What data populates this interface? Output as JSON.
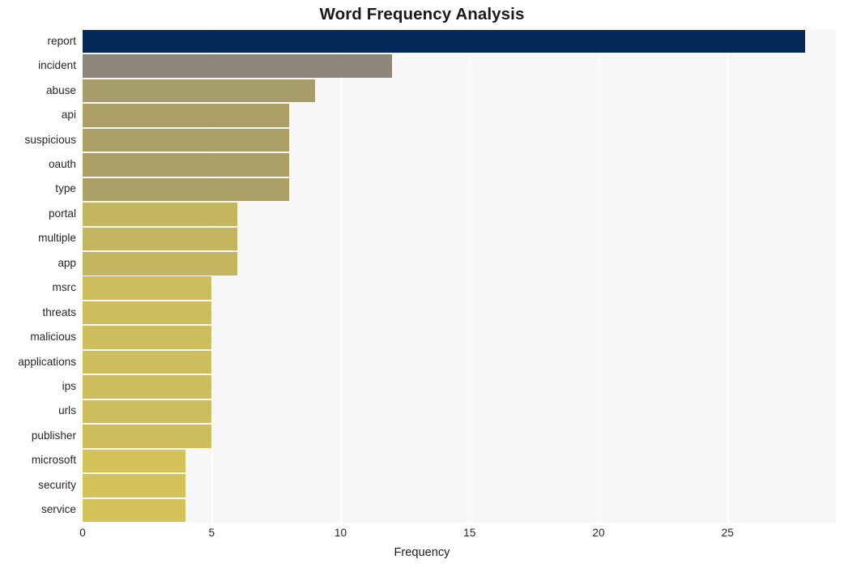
{
  "chart_data": {
    "type": "bar",
    "orientation": "horizontal",
    "title": "Word Frequency Analysis",
    "xlabel": "Frequency",
    "ylabel": "",
    "categories": [
      "report",
      "incident",
      "abuse",
      "api",
      "suspicious",
      "oauth",
      "type",
      "portal",
      "multiple",
      "app",
      "msrc",
      "threats",
      "malicious",
      "applications",
      "ips",
      "urls",
      "publisher",
      "microsoft",
      "security",
      "service"
    ],
    "values": [
      28,
      12,
      9,
      8,
      8,
      8,
      8,
      6,
      6,
      6,
      5,
      5,
      5,
      5,
      5,
      5,
      5,
      4,
      4,
      4
    ],
    "xlim": [
      0,
      29.2
    ],
    "xticks": [
      0,
      5,
      10,
      15,
      20,
      25
    ],
    "xticklabels": [
      "0",
      "5",
      "10",
      "15",
      "20",
      "25"
    ],
    "grid": "vertical-white-on-gray",
    "legend": "none",
    "bar_colors": [
      "#03285a",
      "#8e8779",
      "#a89e6c",
      "#ab9f66",
      "#ab9f66",
      "#ab9f66",
      "#ab9f66",
      "#c4b560",
      "#c4b560",
      "#c4b560",
      "#cdbd5d",
      "#cdbd5d",
      "#cdbd5d",
      "#cdbd5d",
      "#cdbd5d",
      "#cdbd5d",
      "#cdbd5d",
      "#d4c35b",
      "#d4c35b",
      "#d4c35b"
    ],
    "plot_background": "#f7f7f7",
    "figure_background": "#ffffff",
    "text_color": "#262626"
  }
}
